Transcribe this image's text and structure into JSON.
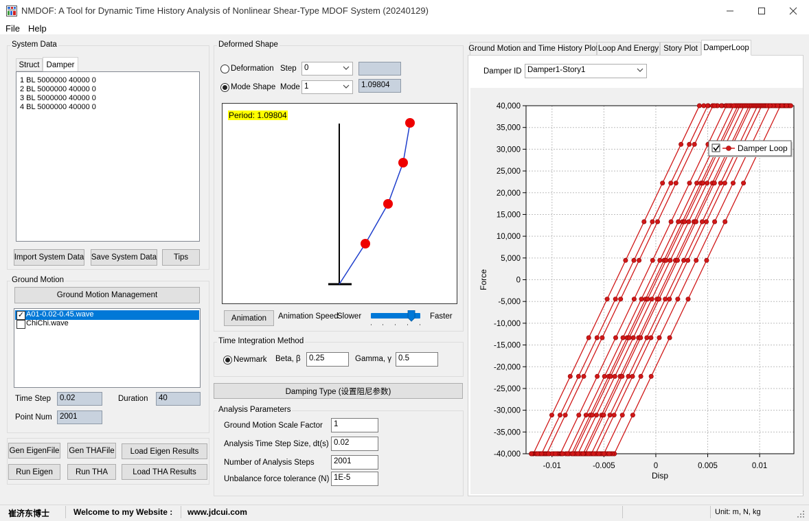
{
  "window": {
    "title": "NMDOF: A Tool for Dynamic Time History Analysis of Nonlinear Shear-Type MDOF System (20240129)"
  },
  "menu": [
    "File",
    "Help"
  ],
  "system_data": {
    "title": "System Data",
    "tabs": [
      "Struct",
      "Damper"
    ],
    "lines": [
      "1 BL 5000000 40000 0",
      "2 BL 5000000 40000 0",
      "3 BL 5000000 40000 0",
      "4 BL 5000000 40000 0"
    ],
    "import_label": "Import System Data",
    "save_label": "Save System Data",
    "tips_label": "Tips"
  },
  "ground_motion": {
    "title": "Ground Motion",
    "manage_label": "Ground Motion Management",
    "items": [
      {
        "label": "A01-0.02-0.45.wave",
        "checked": true
      },
      {
        "label": "ChiChi.wave",
        "checked": false
      }
    ],
    "time_step_label": "Time Step",
    "time_step_value": "0.02",
    "duration_label": "Duration",
    "duration_value": "40",
    "point_num_label": "Point Num",
    "point_num_value": "2001"
  },
  "actions": {
    "gen_eigen": "Gen EigenFile",
    "gen_tha": "Gen THAFile",
    "load_eigen": "Load Eigen Results",
    "run_eigen": "Run Eigen",
    "run_tha": "Run THA",
    "load_tha": "Load THA Results"
  },
  "deformed_shape": {
    "title": "Deformed Shape",
    "deformation_label": "Deformation",
    "step_label": "Step",
    "step_value": "0",
    "mode_shape_label": "Mode Shape",
    "mode_label": "Mode",
    "mode_value": "1",
    "period_display": "1.09804",
    "period_text": "Period: 1.09804",
    "animation_label": "Animation",
    "animation_speed_label": "Animation Speed",
    "slower_label": "Slower",
    "faster_label": "Faster",
    "speed_level": 0.82
  },
  "time_integration": {
    "title": "Time Integration Method",
    "newmark_label": "Newmark",
    "beta_label": "Beta, β",
    "beta_value": "0.25",
    "gamma_label": "Gamma, γ",
    "gamma_value": "0.5"
  },
  "damping_label": "Damping Type (设置阻尼参数)",
  "analysis": {
    "title": "Analysis Parameters",
    "scale_label": "Ground Motion Scale Factor",
    "scale_value": "1",
    "dt_label": "Analysis Time Step Size, dt(s)",
    "dt_value": "0.02",
    "steps_label": "Number of Analysis Steps",
    "steps_value": "2001",
    "tol_label": "Unbalance force tolerance (N)",
    "tol_value": "1E-5"
  },
  "right_tabs": [
    "Ground Motion and Time History Plot",
    "Loop And Energy",
    "Story Plot",
    "DamperLoop"
  ],
  "damper": {
    "id_label": "Damper ID",
    "id_value": "Damper1-Story1"
  },
  "chart_data": {
    "type": "line",
    "xlabel": "Disp",
    "ylabel": "Force",
    "xlim": [
      -0.0125,
      0.0133
    ],
    "ylim": [
      -40000,
      40000
    ],
    "xticks": [
      "-0.01",
      "-0.005",
      "0",
      "0.005",
      "0.01"
    ],
    "yticks": [
      "40,000",
      "35,000",
      "30,000",
      "25,000",
      "20,000",
      "15,000",
      "10,000",
      "5,000",
      "0",
      "-5,000",
      "-10,000",
      "-15,000",
      "-20,000",
      "-25,000",
      "-30,000",
      "-35,000",
      "-40,000"
    ],
    "grid": true,
    "legend_position": "top-right",
    "series": [
      {
        "name": "Damper Loop",
        "color": "#d01818",
        "loops": [
          {
            "k": 5000000,
            "xmin": -0.012,
            "xmax": 0.008,
            "upper_offset": -0.0001,
            "lower_offset": -0.0038
          },
          {
            "k": 5000000,
            "xmin": -0.0115,
            "xmax": 0.0095,
            "upper_offset": 0.001,
            "lower_offset": -0.0025
          },
          {
            "k": 5000000,
            "xmin": -0.009,
            "xmax": 0.011,
            "upper_offset": 0.0018,
            "lower_offset": -0.0012
          },
          {
            "k": 5000000,
            "xmin": -0.007,
            "xmax": 0.0125,
            "upper_offset": 0.003,
            "lower_offset": 0.0001
          },
          {
            "k": 5000000,
            "xmin": -0.006,
            "xmax": 0.013,
            "upper_offset": 0.004,
            "lower_offset": 0.0012
          },
          {
            "k": 5000000,
            "xmin": -0.005,
            "xmax": 0.011,
            "upper_offset": 0.0005,
            "lower_offset": -0.003
          },
          {
            "k": 5000000,
            "xmin": -0.004,
            "xmax": 0.009,
            "upper_offset": 0.0022,
            "lower_offset": -0.0005
          }
        ]
      }
    ]
  },
  "status": {
    "name": "崔济东博士",
    "welcome": "Welcome to my Website :",
    "website": "www.jdcui.com",
    "units": "Unit: m, N, kg"
  },
  "colors": {
    "selection": "#0078d7",
    "loop_line": "#d01818",
    "mode_line": "#1f3fcc",
    "period_bg": "#ffff00"
  },
  "icons": {
    "app": "grid-app-icon",
    "minimize": "minimize-icon",
    "maximize": "maximize-icon",
    "close": "close-icon"
  }
}
